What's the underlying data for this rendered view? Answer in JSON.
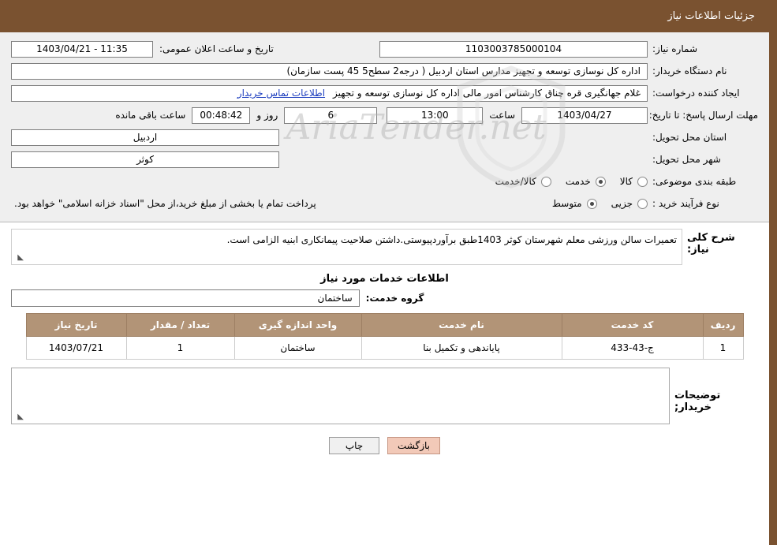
{
  "header": {
    "title": "جزئیات اطلاعات نیاز"
  },
  "form": {
    "need_number_label": "شماره نیاز:",
    "need_number_value": "1103003785000104",
    "announce_datetime_label": "تاریخ و ساعت اعلان عمومی:",
    "announce_datetime_value": "1403/04/21 - 11:35",
    "buyer_org_label": "نام دستگاه خریدار:",
    "buyer_org_value": "اداره کل نوسازی   توسعه و تجهیز مدارس استان اردبیل ( درجه2  سطح5  45 پست سازمان)",
    "requester_label": "ایجاد کننده درخواست:",
    "requester_value": "غلام جهانگیری قره چناق کارشناس امور مالی اداره کل نوسازی   توسعه و تجهیز",
    "contact_link": "اطلاعات تماس خریدار",
    "deadline_label": "مهلت ارسال پاسخ: تا تاریخ:",
    "deadline_date": "1403/04/27",
    "hour_label": "ساعت",
    "deadline_time": "13:00",
    "days_value": "6",
    "days_label": "روز و",
    "countdown_value": "00:48:42",
    "remaining_label": "ساعت باقی مانده",
    "province_label": "استان محل تحویل:",
    "province_value": "اردبیل",
    "city_label": "شهر محل تحویل:",
    "city_value": "کوثر",
    "category_label": "طبقه بندی موضوعی:",
    "category_options": [
      {
        "label": "کالا",
        "checked": false
      },
      {
        "label": "خدمت",
        "checked": true
      },
      {
        "label": "کالا/خدمت",
        "checked": false
      }
    ],
    "purchase_type_label": "نوع فرآیند خرید :",
    "purchase_options": [
      {
        "label": "جزیی",
        "checked": false
      },
      {
        "label": "متوسط",
        "checked": true
      }
    ],
    "purchase_note": "پرداخت تمام یا بخشی از مبلغ خرید،از محل \"اسناد خزانه اسلامی\" خواهد بود."
  },
  "description": {
    "label": "شرح کلی نیاز:",
    "text": "تعمیرات سالن ورزشی معلم شهرستان کوثر 1403طبق برآوردپیوستی.داشتن صلاحیت پیمانکاری ابنیه الزامی است."
  },
  "services": {
    "section_title": "اطلاعات خدمات مورد نیاز",
    "group_label": "گروه خدمت:",
    "group_value": "ساختمان",
    "columns": [
      "ردیف",
      "کد خدمت",
      "نام خدمت",
      "واحد اندازه گیری",
      "تعداد / مقدار",
      "تاریخ نیاز"
    ],
    "rows": [
      {
        "index": "1",
        "code": "ج-43-433",
        "name": "پایاندهی و تکمیل بنا",
        "unit": "ساختمان",
        "quantity": "1",
        "date": "1403/07/21"
      }
    ]
  },
  "buyer_comments": {
    "label": "توضیحات خریدار;",
    "text": ""
  },
  "footer": {
    "print_label": "چاپ",
    "back_label": "بازگشت"
  },
  "watermark": {
    "text": "AriaTender.net"
  }
}
